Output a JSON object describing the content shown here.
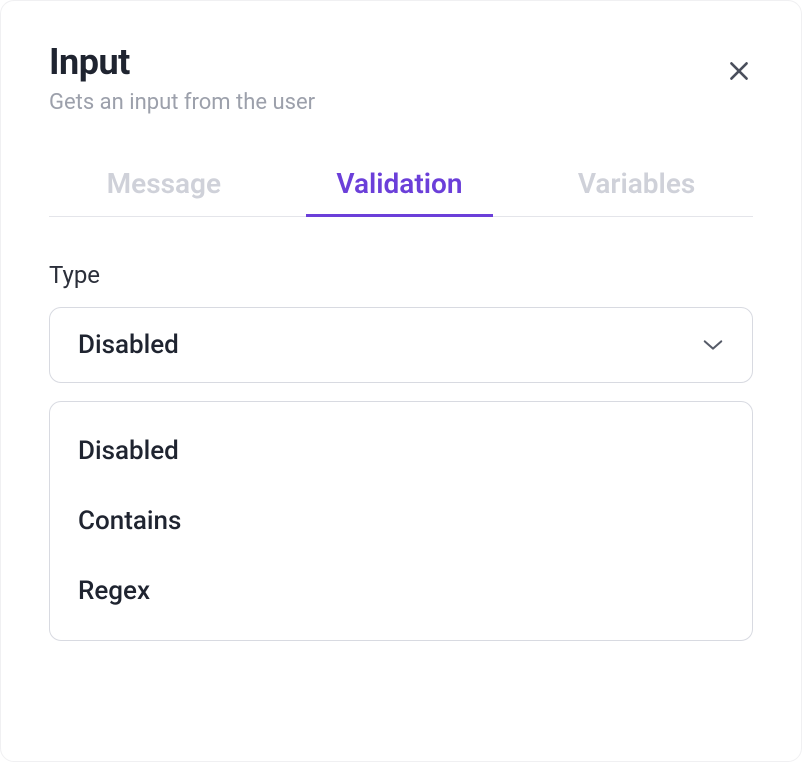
{
  "header": {
    "title": "Input",
    "subtitle": "Gets an input from the user"
  },
  "tabs": {
    "message": "Message",
    "validation": "Validation",
    "variables": "Variables",
    "active": "validation"
  },
  "field": {
    "label": "Type",
    "selected": "Disabled"
  },
  "dropdown": {
    "options": [
      "Disabled",
      "Contains",
      "Regex"
    ]
  },
  "colors": {
    "accent": "#6b3fd9",
    "text_primary": "#1f2430",
    "text_muted": "#9ca0ab",
    "tab_inactive": "#cfd1d9",
    "border": "#d8dae1"
  }
}
